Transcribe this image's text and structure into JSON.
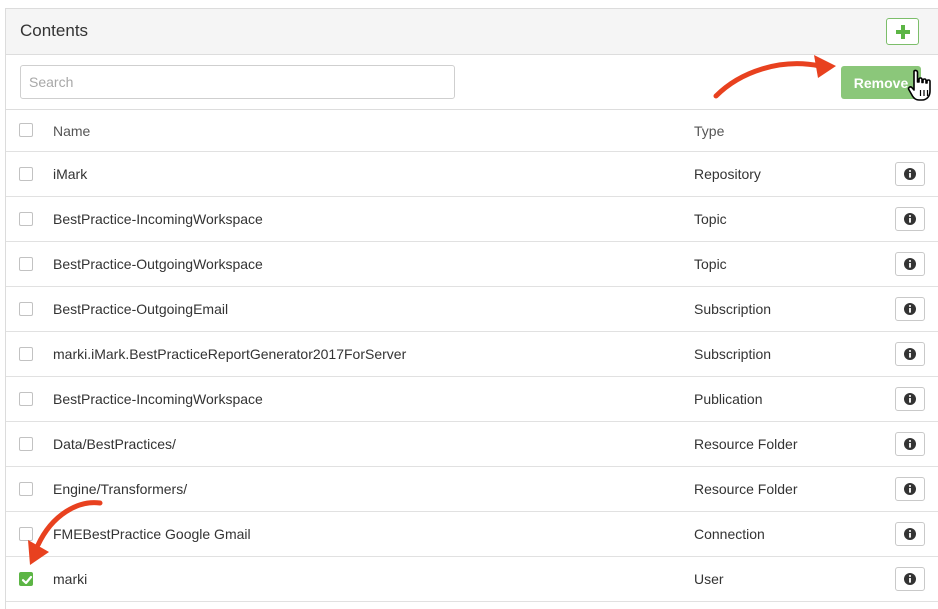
{
  "panel": {
    "title": "Contents"
  },
  "toolbar": {
    "add_icon": "plus-icon",
    "search_placeholder": "Search",
    "search_value": "",
    "remove_label": "Remove"
  },
  "table": {
    "columns": {
      "name": "Name",
      "type": "Type"
    },
    "rows": [
      {
        "name": "iMark",
        "type": "Repository",
        "checked": false
      },
      {
        "name": "BestPractice-IncomingWorkspace",
        "type": "Topic",
        "checked": false
      },
      {
        "name": "BestPractice-OutgoingWorkspace",
        "type": "Topic",
        "checked": false
      },
      {
        "name": "BestPractice-OutgoingEmail",
        "type": "Subscription",
        "checked": false
      },
      {
        "name": "marki.iMark.BestPracticeReportGenerator2017ForServer",
        "type": "Subscription",
        "checked": false
      },
      {
        "name": "BestPractice-IncomingWorkspace",
        "type": "Publication",
        "checked": false
      },
      {
        "name": "Data/BestPractices/",
        "type": "Resource Folder",
        "checked": false
      },
      {
        "name": "Engine/Transformers/",
        "type": "Resource Folder",
        "checked": false
      },
      {
        "name": "FMEBestPractice Google Gmail",
        "type": "Connection",
        "checked": false
      },
      {
        "name": "marki",
        "type": "User",
        "checked": true
      }
    ]
  },
  "colors": {
    "accent_green": "#5cb545",
    "remove_button": "#8bc77a",
    "arrow_red": "#e8411f"
  }
}
